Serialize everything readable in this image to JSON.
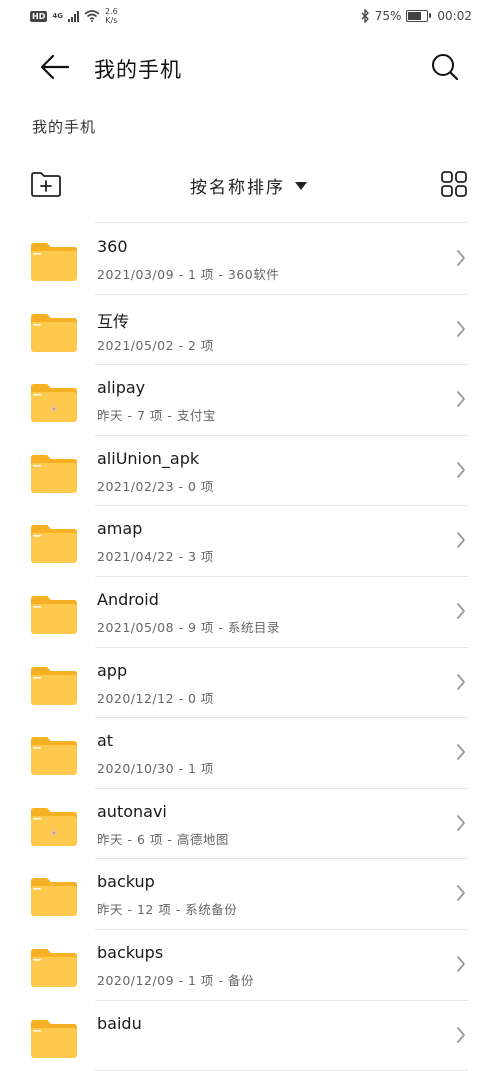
{
  "status_bar": {
    "hd": "HD",
    "network": "4G",
    "speed_value": "2.6",
    "speed_unit": "K/s",
    "battery_percent": "75%",
    "battery_level": 0.75,
    "time": "00:02"
  },
  "header": {
    "title": "我的手机"
  },
  "breadcrumb": "我的手机",
  "toolbar": {
    "sort_label": "按名称排序"
  },
  "colors": {
    "folder": "#FFC94D",
    "folder_tab": "#F5B024"
  },
  "files": [
    {
      "name": "360",
      "meta": "2021/03/09 - 1 项 - 360软件",
      "badge": false
    },
    {
      "name": "互传",
      "meta": "2021/05/02 - 2 项",
      "badge": false
    },
    {
      "name": "alipay",
      "meta": "昨天 - 7 项 - 支付宝",
      "badge": true
    },
    {
      "name": "aliUnion_apk",
      "meta": "2021/02/23 - 0 项",
      "badge": false
    },
    {
      "name": "amap",
      "meta": "2021/04/22 - 3 项",
      "badge": false
    },
    {
      "name": "Android",
      "meta": "2021/05/08 - 9 项 - 系统目录",
      "badge": false
    },
    {
      "name": "app",
      "meta": "2020/12/12 - 0 项",
      "badge": false
    },
    {
      "name": "at",
      "meta": "2020/10/30 - 1 项",
      "badge": false
    },
    {
      "name": "autonavi",
      "meta": "昨天 - 6 项 - 高德地图",
      "badge": true
    },
    {
      "name": "backup",
      "meta": "昨天 - 12 项 - 系统备份",
      "badge": false
    },
    {
      "name": "backups",
      "meta": "2020/12/09 - 1 项 - 备份",
      "badge": false
    },
    {
      "name": "baidu",
      "meta": "",
      "badge": false
    }
  ]
}
